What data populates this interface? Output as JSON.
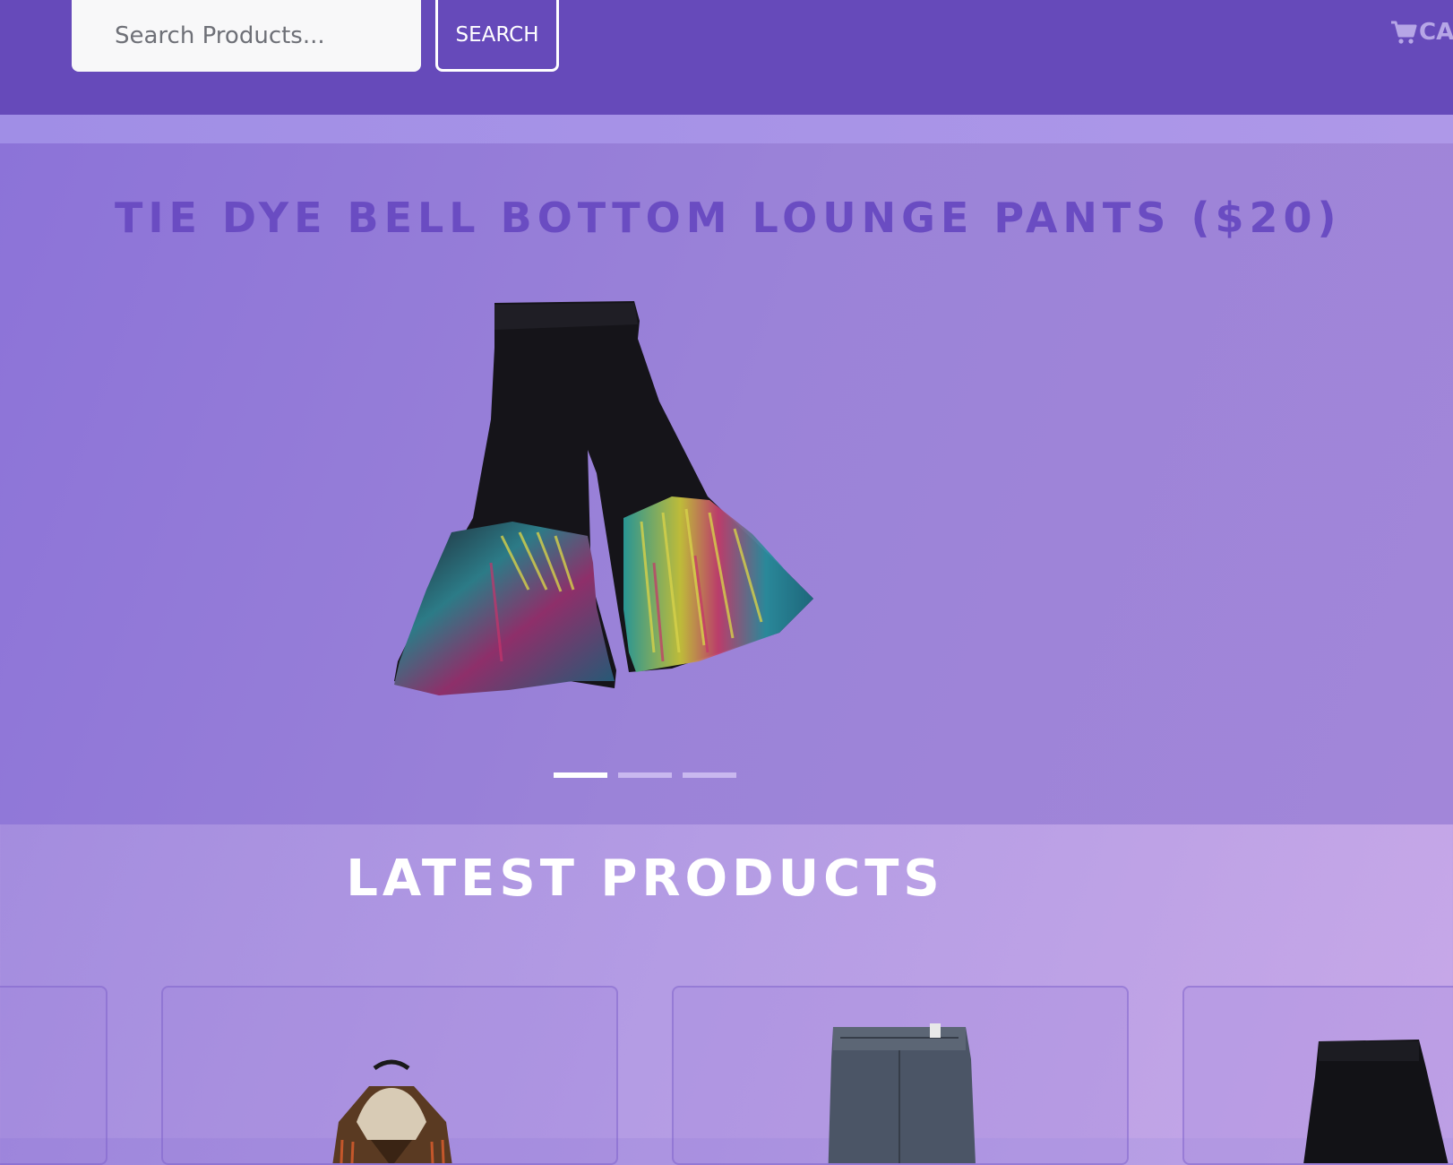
{
  "header": {
    "search_placeholder": "Search Products...",
    "search_button_label": "SEARCH",
    "cart_label": "CA",
    "cart_icon": "shopping-cart-icon"
  },
  "carousel": {
    "title": "TIE DYE BELL BOTTOM LOUNGE PANTS ($20)",
    "indicators": 3,
    "active_index": 0
  },
  "latest": {
    "title": "LATEST PRODUCTS"
  },
  "colors": {
    "navbar": "#664aba",
    "accent_title": "#6a4cc2",
    "white": "#ffffff"
  }
}
